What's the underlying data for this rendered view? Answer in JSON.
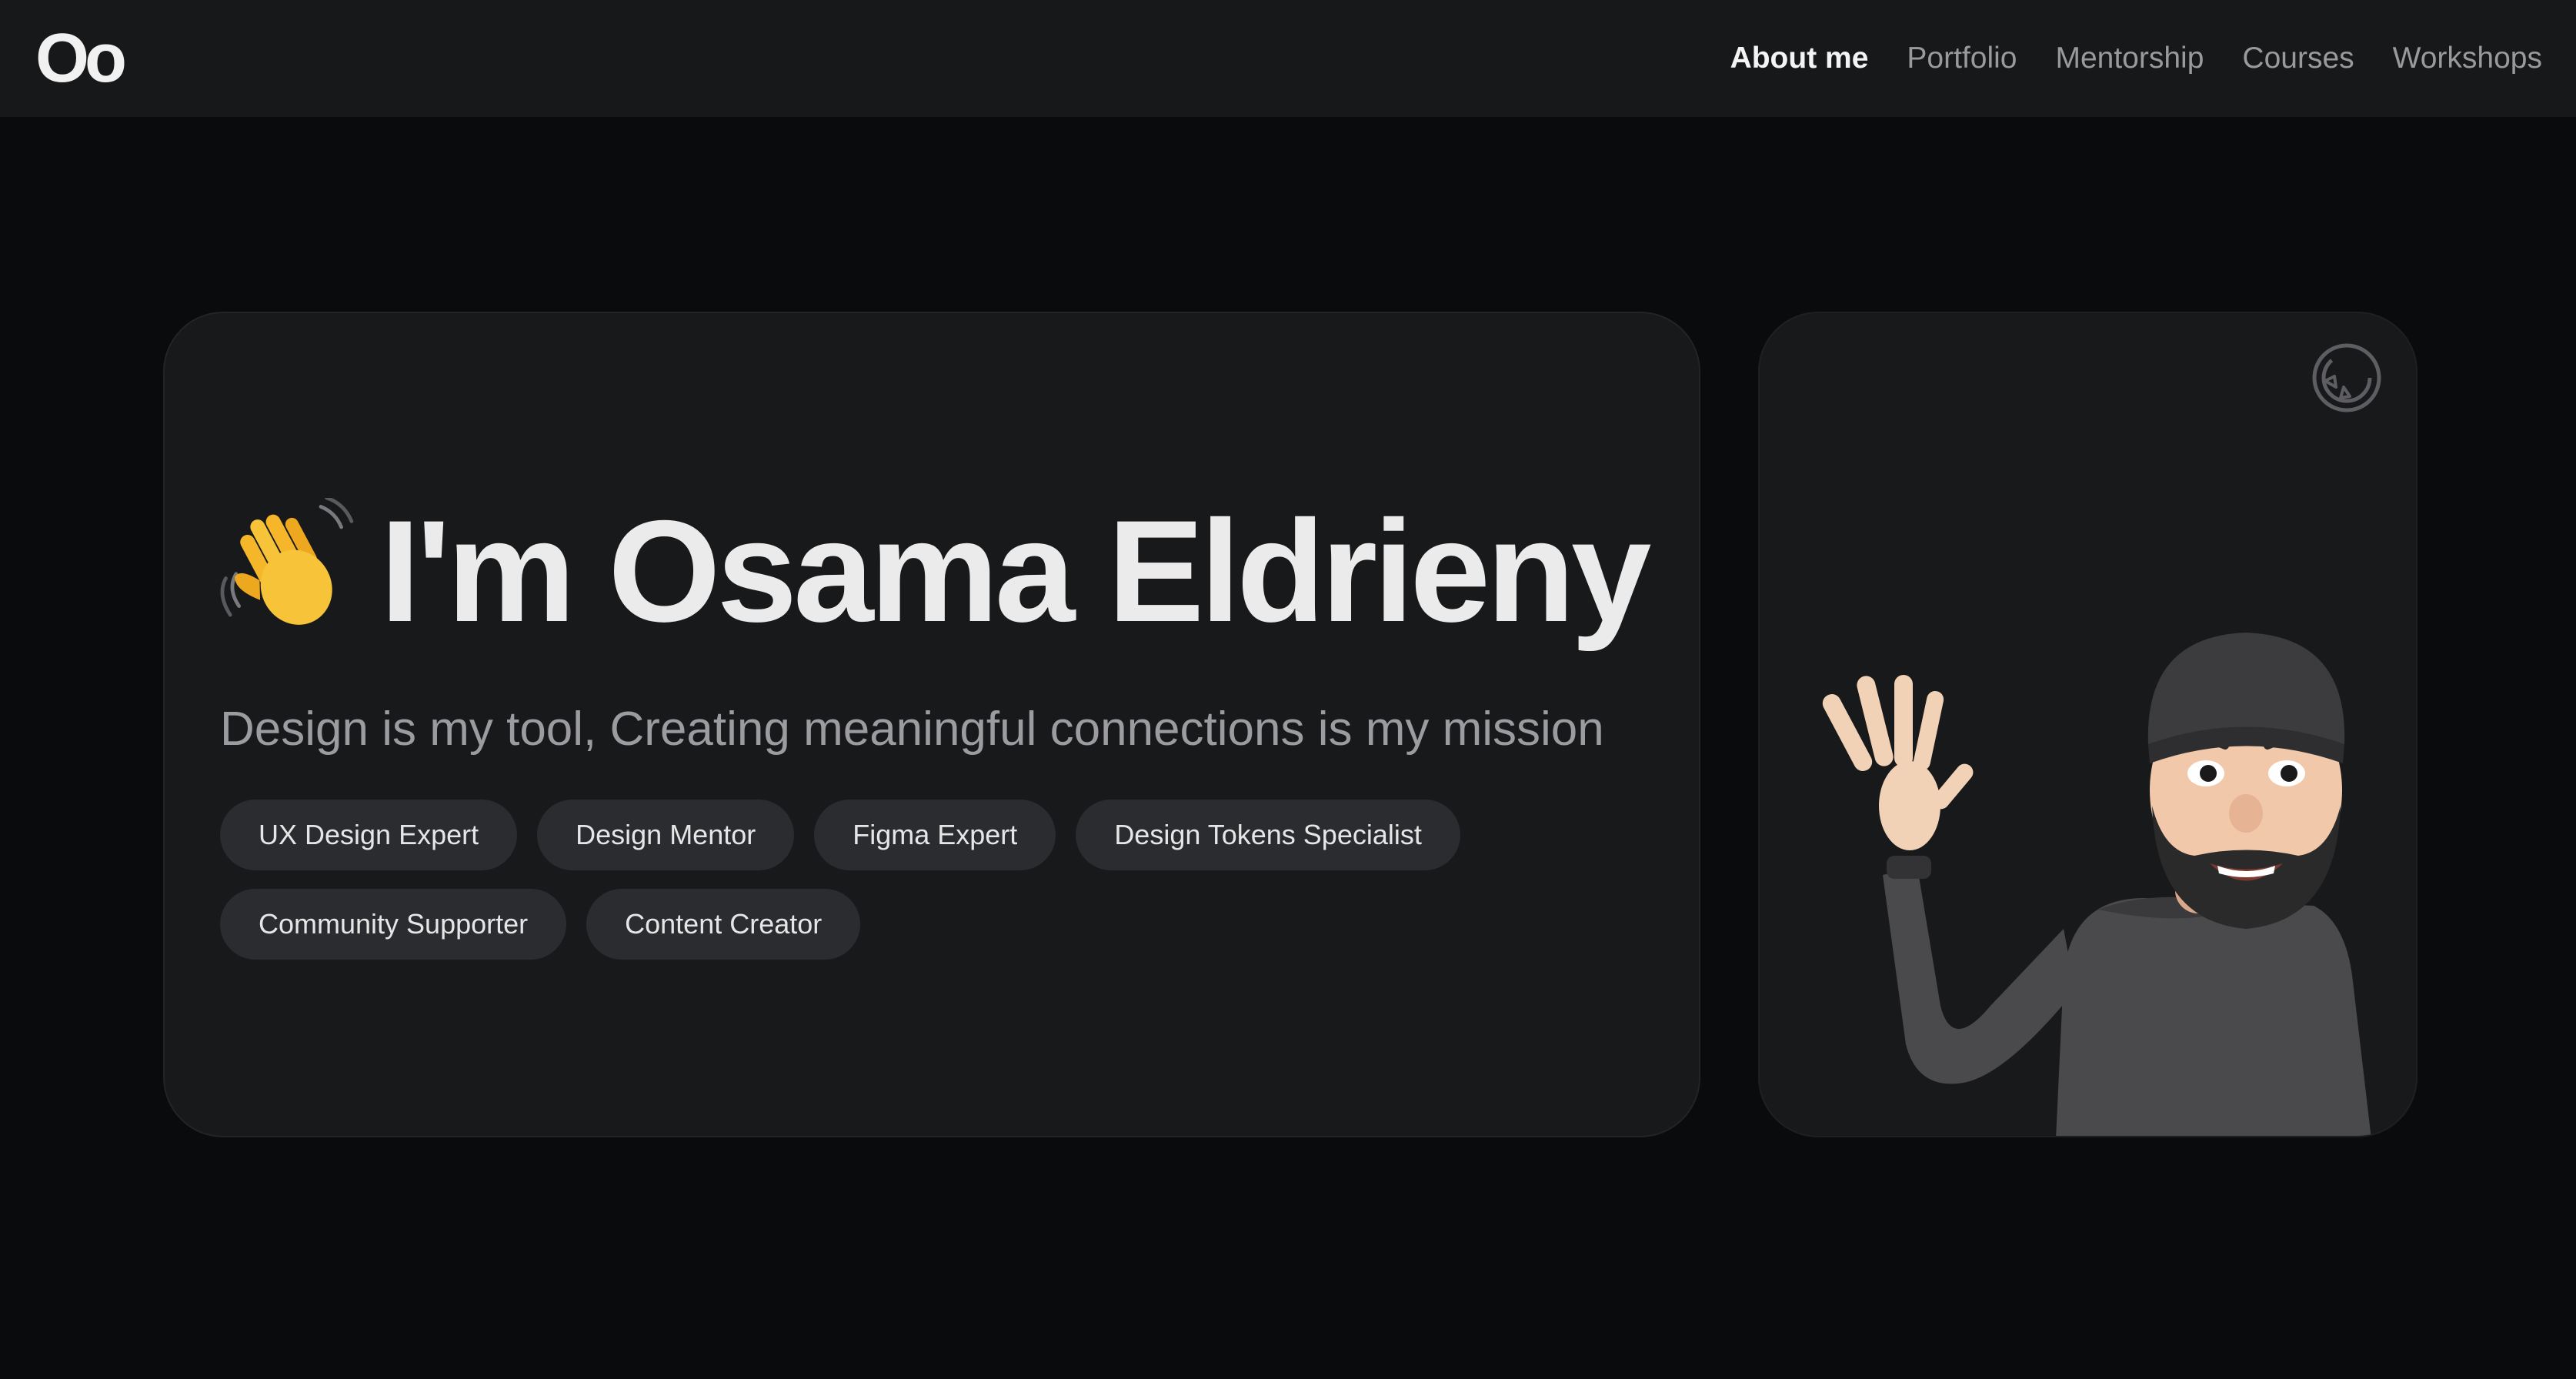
{
  "header": {
    "logo": "Oo",
    "nav": [
      {
        "label": "About me",
        "active": true
      },
      {
        "label": "Portfolio",
        "active": false
      },
      {
        "label": "Mentorship",
        "active": false
      },
      {
        "label": "Courses",
        "active": false
      },
      {
        "label": "Workshops",
        "active": false
      }
    ]
  },
  "hero": {
    "wave_icon": "waving-hand-emoji",
    "title": "I'm Osama Eldrieny",
    "subtitle": "Design is my tool, Creating meaningful connections is my mission",
    "tags": [
      "UX Design Expert",
      "Design Mentor",
      "Figma Expert",
      "Design Tokens Specialist",
      "Community Supporter",
      "Content Creator"
    ]
  },
  "avatar_card": {
    "corner_icon": "sticker-icon",
    "avatar": "memoji-waving-avatar"
  },
  "colors": {
    "page_bg": "#0a0b0c",
    "header_bg": "#17181a",
    "card_bg": "#18191b",
    "tag_bg": "#2b2c30",
    "title_text": "#ebebeb",
    "muted_text": "#9c9ca0"
  }
}
